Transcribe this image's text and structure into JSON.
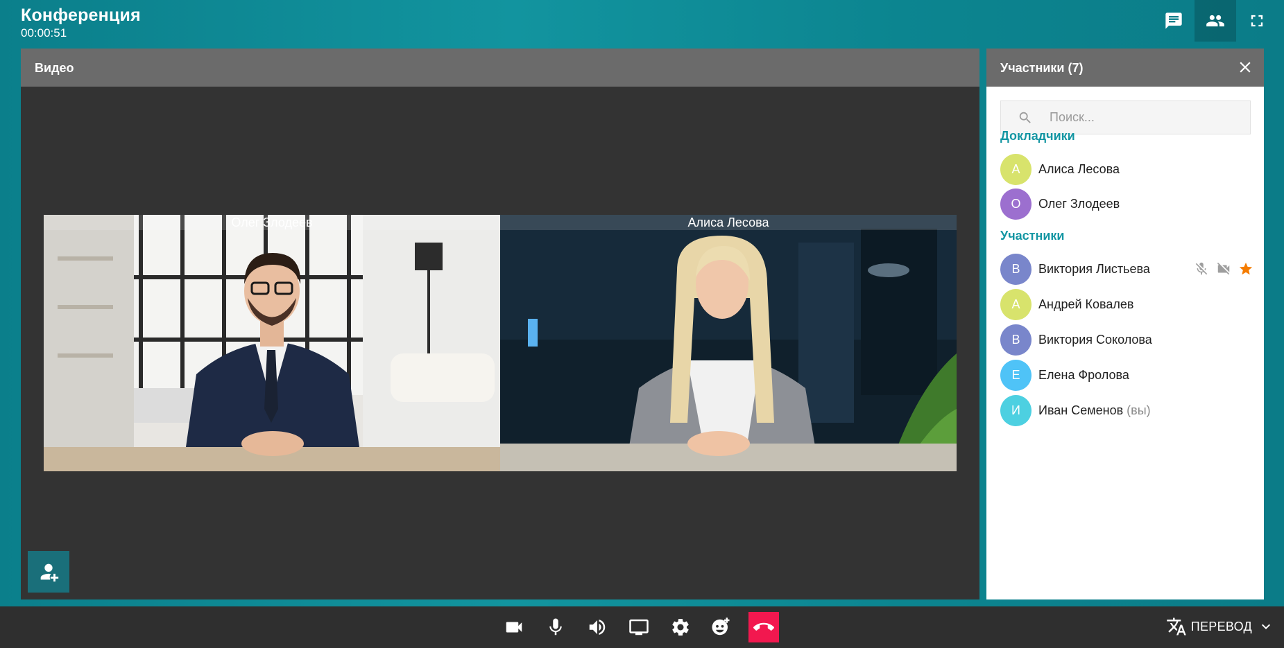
{
  "header": {
    "title": "Конференция",
    "timer": "00:00:51",
    "buttons": [
      {
        "icon": "chat-icon"
      },
      {
        "icon": "people-icon",
        "active": true
      },
      {
        "icon": "fullscreen-icon"
      }
    ]
  },
  "video": {
    "title": "Видео",
    "tiles": [
      {
        "name": "Олег Злодеев"
      },
      {
        "name": "Алиса Лесова"
      }
    ],
    "add_user_icon": "add-user-icon"
  },
  "participants": {
    "title": "Участники (7)",
    "search_placeholder": "Поиск...",
    "speakers_title": "Докладчики",
    "speakers": [
      {
        "initial": "А",
        "name": "Алиса Лесова",
        "color": "#d8e36c"
      },
      {
        "initial": "О",
        "name": "Олег Злодеев",
        "color": "#9c6fcf"
      }
    ],
    "members_title": "Участники",
    "members": [
      {
        "initial": "В",
        "name": "Виктория Листьева",
        "color": "#7986cb",
        "muted_icons": [
          "mic-off-icon",
          "video-off-icon",
          "star-icon"
        ]
      },
      {
        "initial": "А",
        "name": "Андрей Ковалев",
        "color": "#d8e36c"
      },
      {
        "initial": "В",
        "name": "Виктория Соколова",
        "color": "#7986cb"
      },
      {
        "initial": "Е",
        "name": "Елена Фролова",
        "color": "#4fc3f7"
      },
      {
        "initial": "И",
        "name": "Иван Семенов",
        "suffix": "(вы)",
        "color": "#4dd0e1"
      }
    ],
    "accent_color": "#1496a3",
    "star_color": "#f57c00"
  },
  "controls": {
    "buttons": [
      "camera-icon",
      "mic-icon",
      "volume-icon",
      "screen-share-icon",
      "settings-icon",
      "emoji-add-icon",
      "hangup-icon"
    ],
    "translate_label": "ПЕРЕВОД"
  }
}
